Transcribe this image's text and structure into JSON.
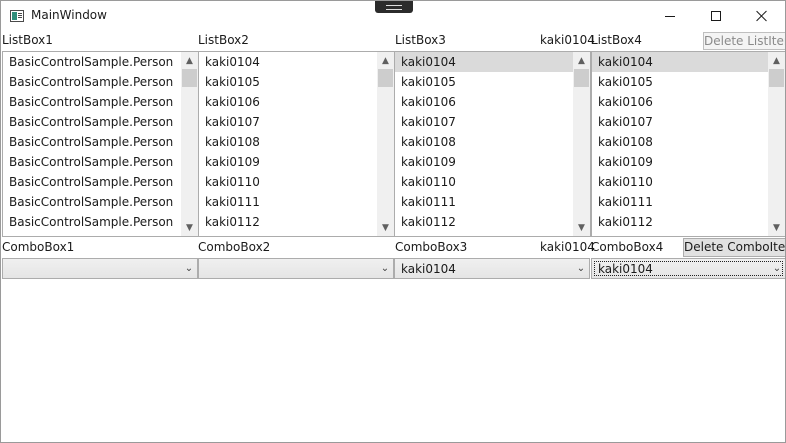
{
  "window": {
    "title": "MainWindow"
  },
  "labels": {
    "listbox1": "ListBox1",
    "listbox2": "ListBox2",
    "listbox3": "ListBox3",
    "listbox3_selected": "kaki0104",
    "listbox4": "ListBox4",
    "combobox1": "ComboBox1",
    "combobox2": "ComboBox2",
    "combobox3": "ComboBox3",
    "combobox3_selected": "kaki0104",
    "combobox4": "ComboBox4"
  },
  "buttons": {
    "delete_list_item": "Delete ListItem",
    "delete_combo_item": "Delete ComboItem"
  },
  "listbox1": {
    "items": [
      "BasicControlSample.Person",
      "BasicControlSample.Person",
      "BasicControlSample.Person",
      "BasicControlSample.Person",
      "BasicControlSample.Person",
      "BasicControlSample.Person",
      "BasicControlSample.Person",
      "BasicControlSample.Person",
      "BasicControlSample.Person"
    ]
  },
  "listbox2": {
    "items": [
      "kaki0104",
      "kaki0105",
      "kaki0106",
      "kaki0107",
      "kaki0108",
      "kaki0109",
      "kaki0110",
      "kaki0111",
      "kaki0112"
    ]
  },
  "listbox3": {
    "items": [
      "kaki0104",
      "kaki0105",
      "kaki0106",
      "kaki0107",
      "kaki0108",
      "kaki0109",
      "kaki0110",
      "kaki0111",
      "kaki0112"
    ]
  },
  "listbox4": {
    "items": [
      "kaki0104",
      "kaki0105",
      "kaki0106",
      "kaki0107",
      "kaki0108",
      "kaki0109",
      "kaki0110",
      "kaki0111",
      "kaki0112"
    ]
  },
  "combos": {
    "combobox1_value": "",
    "combobox2_value": "",
    "combobox3_value": "kaki0104",
    "combobox4_value": "kaki0104"
  },
  "icons": {
    "app": "app-window-icon",
    "minimize": "minimize-icon",
    "maximize": "maximize-icon",
    "close": "close-icon"
  }
}
